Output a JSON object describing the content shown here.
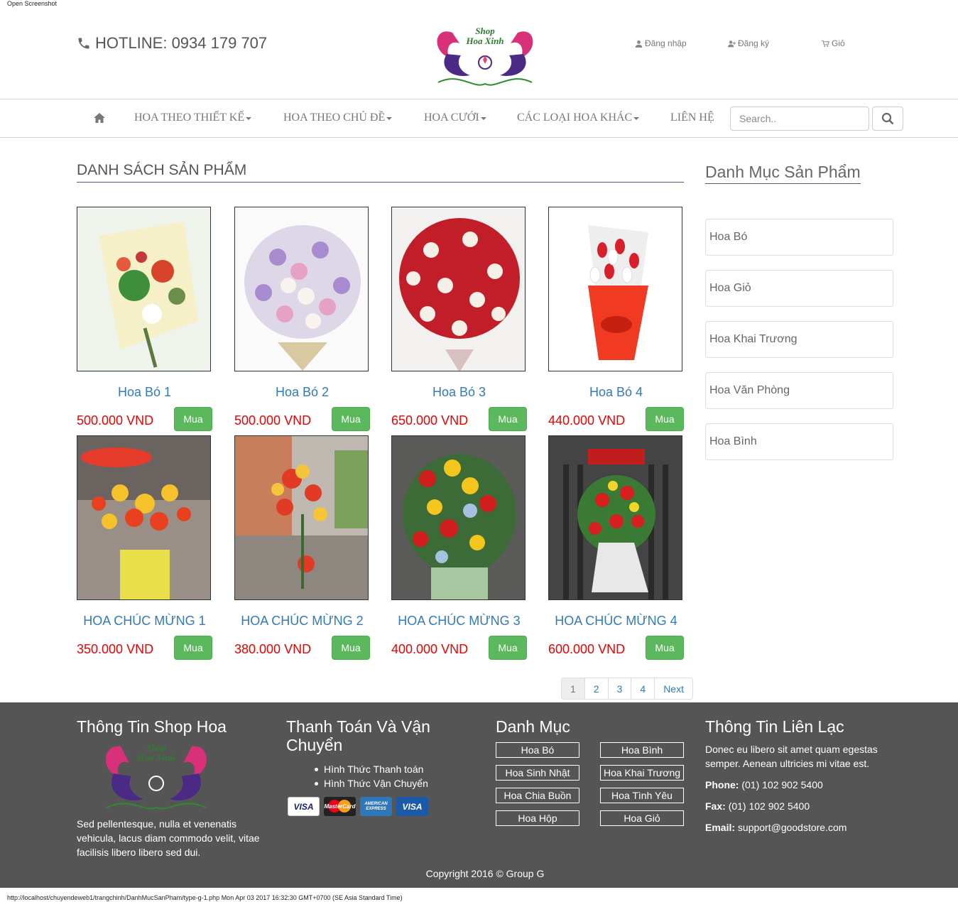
{
  "caption": "Open Screenshot",
  "header": {
    "hotline": "HOTLINE: 0934 179 707",
    "logo_text_1": "Shop",
    "logo_text_2": "Hoa Xinh",
    "login": "Đăng nhập",
    "register": "Đăng ký",
    "cart": "Giỏ"
  },
  "nav": {
    "items": [
      "HOA THEO THIẾT KẾ",
      "HOA THEO CHỦ ĐỀ",
      "HOA CƯỚI",
      "CÁC LOẠI HOA KHÁC",
      "LIÊN HỆ"
    ],
    "search_placeholder": "Search.."
  },
  "main": {
    "title": "DANH SÁCH SẢN PHẨM",
    "buy_label": "Mua",
    "products": [
      {
        "name": "Hoa Bó 1",
        "price": "500.000 VND"
      },
      {
        "name": "Hoa Bó 2",
        "price": "500.000 VND"
      },
      {
        "name": "Hoa Bó 3",
        "price": "650.000 VND"
      },
      {
        "name": "Hoa Bó 4",
        "price": "440.000 VND"
      },
      {
        "name": "HOA CHÚC MỪNG 1",
        "price": "350.000 VND"
      },
      {
        "name": "HOA CHÚC MỪNG 2",
        "price": "380.000 VND"
      },
      {
        "name": "HOA CHÚC MỪNG 3",
        "price": "400.000 VND"
      },
      {
        "name": "HOA CHÚC MỪNG 4",
        "price": "600.000 VND"
      }
    ],
    "pagination": [
      "1",
      "2",
      "3",
      "4",
      "Next"
    ]
  },
  "sidebar": {
    "title": "Danh Mục Sản Phẩm",
    "items": [
      "Hoa Bó",
      "Hoa Giỏ",
      "Hoa Khai Trương",
      "Hoa Văn Phòng",
      "Hoa Bình"
    ]
  },
  "footer": {
    "shop_title": "Thông Tin Shop Hoa",
    "shop_desc": "Sed pellentesque, nulla et venenatis vehicula, lacus diam commodo velit, vitae facilisis libero libero sed dui.",
    "payment_title": "Thanh Toán Và Vận Chuyển",
    "payment_items": [
      "Hình Thức Thanh toán",
      "Hình Thức Vận Chuyển"
    ],
    "cards": [
      "VISA",
      "MasterCard",
      "AMERICAN EXPRESS",
      "VISA"
    ],
    "category_title": "Danh Mục",
    "categories": [
      "Hoa Bó",
      "Hoa Bình",
      "Hoa Sinh Nhật",
      "Hoa Khai Trương",
      "Hoa Chia Buồn",
      "Hoa Tình Yêu",
      "Hoa Hộp",
      "Hoa Giỏ"
    ],
    "contact_title": "Thông Tin Liên Lạc",
    "contact_desc": "Donec eu libero sit amet quam egestas semper. Aenean ultricies mi vitae est.",
    "phone_label": "Phone:",
    "phone": "(01) 102 902 5400",
    "fax_label": "Fax:",
    "fax": "(01) 102 902 5400",
    "email_label": "Email:",
    "email": "support@goodstore.com",
    "copyright": "Copyright 2016 © Group G"
  },
  "status_bar": "http://localhost/chuyendeweb1/trangchinh/DanhMucSanPham/type-g-1.php Mon Apr 03 2017 16:32:30 GMT+0700 (SE Asia Standard Time)",
  "colors": {
    "link": "#337ab7",
    "price": "#ee0000",
    "buy_button": "#5cb85c",
    "footer_bg": "#555555"
  }
}
